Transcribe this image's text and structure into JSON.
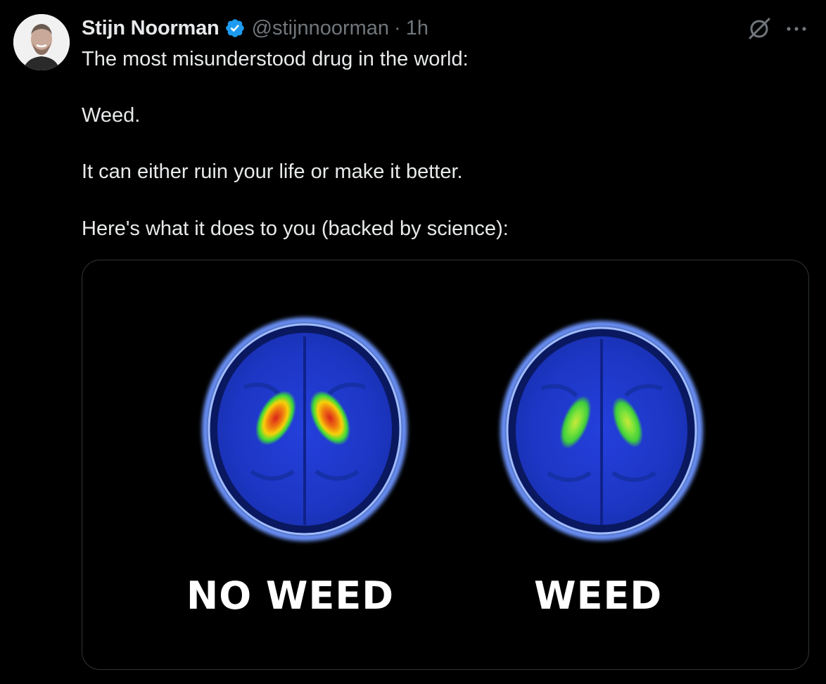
{
  "author": {
    "display_name": "Stijn Noorman",
    "handle": "@stijnnoorman",
    "separator": "·",
    "time": "1h",
    "verified_icon": "verified-badge-icon",
    "avatar_icon": "profile-avatar"
  },
  "actions": {
    "grok_icon": "grok-icon",
    "more_icon": "more-options-icon"
  },
  "tweet": {
    "lines": [
      "The most misunderstood drug in the world:",
      "Weed.",
      "It can either ruin your life or make it better.",
      "Here's what it does to you (backed by science):"
    ]
  },
  "media": {
    "left_label": "NO WEED",
    "right_label": "WEED",
    "colors": {
      "brain_blue": "#1f3fd6",
      "outline": "#7fa6ff",
      "hot": "#e83a10",
      "warm": "#f5d20a",
      "green": "#3edb38"
    }
  },
  "colors": {
    "background": "#000000",
    "text": "#e7e9ea",
    "muted": "#71767b",
    "verified": "#1d9bf0",
    "border": "#2f3336"
  }
}
